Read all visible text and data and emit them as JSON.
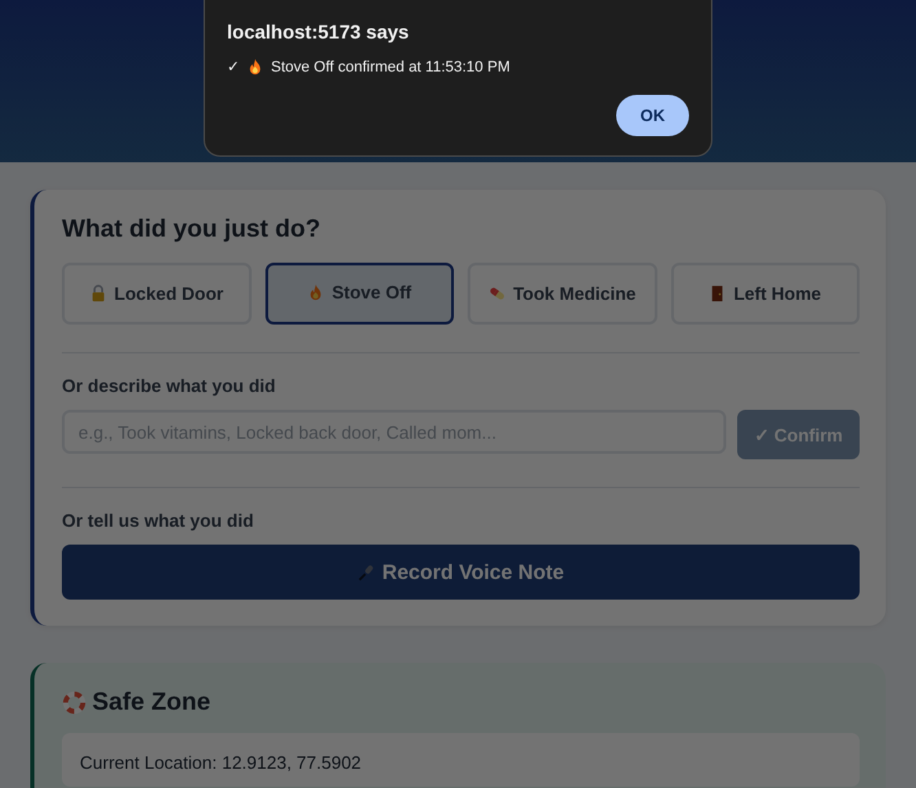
{
  "dialog": {
    "title": "localhost:5173 says",
    "check": "✓",
    "message": "Stove Off confirmed at 11:53:10 PM",
    "ok_button": "OK"
  },
  "action_panel": {
    "title": "What did you just do?",
    "actions": [
      {
        "label": "Locked Door",
        "selected": false
      },
      {
        "label": "Stove Off",
        "selected": true
      },
      {
        "label": "Took Medicine",
        "selected": false
      },
      {
        "label": "Left Home",
        "selected": false
      }
    ]
  },
  "describe": {
    "label": "Or describe what you did",
    "placeholder": "e.g., Took vitamins, Locked back door, Called mom...",
    "confirm_button": "✓ Confirm",
    "confirm_disabled": true
  },
  "voice": {
    "label": "Or tell us what you did",
    "button": "Record Voice Note"
  },
  "safe_zone": {
    "title": "Safe Zone",
    "location": "Current Location: 12.9123, 77.5902"
  }
}
